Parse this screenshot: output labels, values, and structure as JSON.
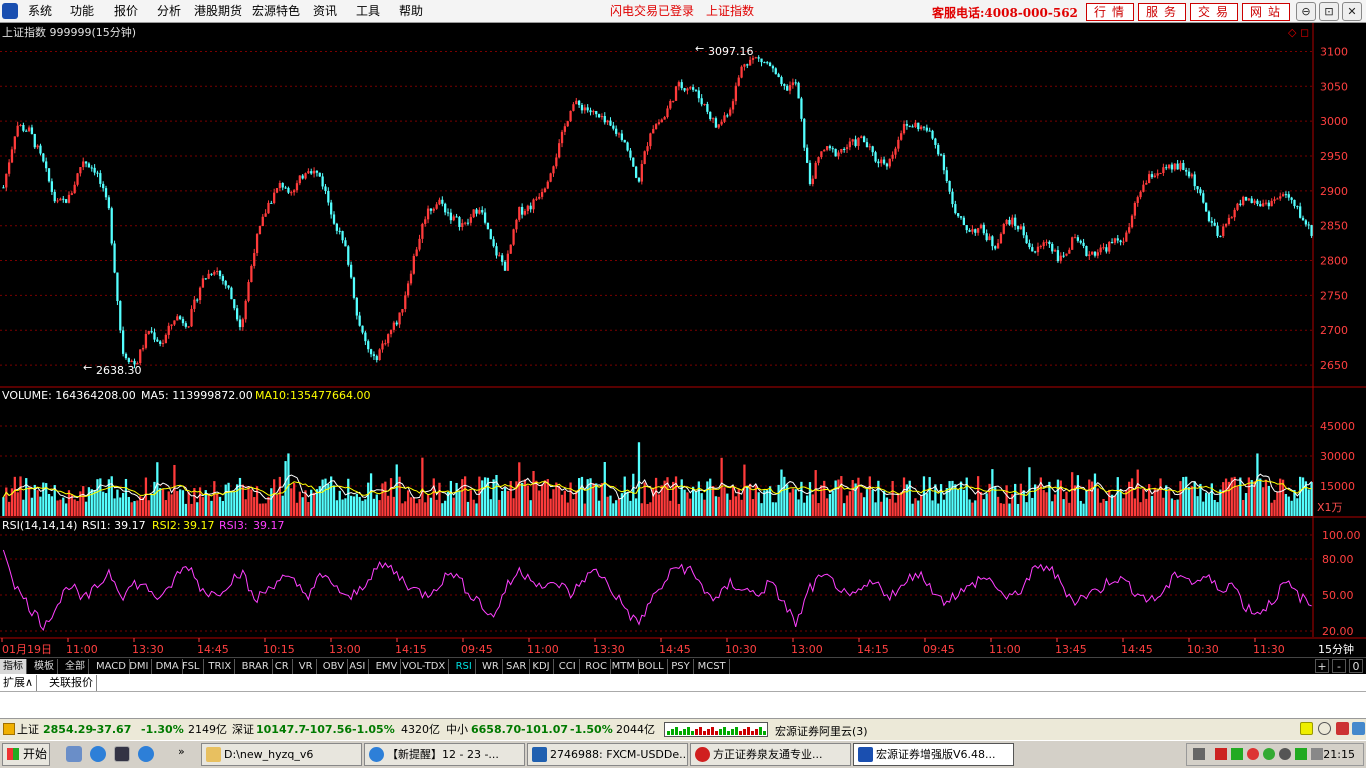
{
  "menu": {
    "items": [
      "系统",
      "功能",
      "报价",
      "分析",
      "港股期货",
      "宏源特色",
      "资讯",
      "工具",
      "帮助"
    ]
  },
  "status": {
    "login": "闪电交易已登录",
    "index": "上证指数"
  },
  "hotline": "客服电话:4008-000-562",
  "top_buttons": [
    "行情",
    "服务",
    "交易",
    "网站"
  ],
  "window_buttons": [
    "⊖",
    "⊡",
    "✕"
  ],
  "chart": {
    "title": "上证指数 999999(15分钟)",
    "price_axis": [
      "3100",
      "3050",
      "3000",
      "2950",
      "2900",
      "2850",
      "2800",
      "2750",
      "2700",
      "2650"
    ],
    "high_label": "3097.16",
    "low_label": "2638.30",
    "volume_header": {
      "label": "VOLUME: 164364208.00",
      "ma5": "MA5: 113999872.00",
      "ma10_name": "MA10:",
      "ma10_value": "135477664.00"
    },
    "volume_axis": [
      "45000",
      "30000",
      "15000"
    ],
    "volume_unit": "X1万",
    "rsi_header": {
      "label": "RSI(14,14,14)",
      "rsi1": "RSI1: 39.17",
      "rsi2_name": "RSI2:",
      "rsi2_value": "39.17",
      "rsi3_name": "RSI3:",
      "rsi3_value": "39.17"
    },
    "rsi_axis": [
      "100.00",
      "80.00",
      "50.00",
      "20.00"
    ],
    "time_labels": [
      "01月19日",
      "11:00",
      "13:30",
      "14:45",
      "10:15",
      "13:00",
      "14:15",
      "09:45",
      "11:00",
      "13:30",
      "14:45",
      "10:30",
      "13:00",
      "14:15",
      "09:45",
      "11:00",
      "13:45",
      "14:45",
      "10:30",
      "11:30"
    ],
    "period": "15分钟"
  },
  "chart_data": {
    "type": "candlestick",
    "title": "上证指数 999999(15分钟)",
    "ylim": [
      2620,
      3115
    ],
    "high": 3097.16,
    "low": 2638.3,
    "close_path": [
      2905,
      2995,
      2985,
      2940,
      2880,
      2890,
      2945,
      2930,
      2870,
      2670,
      2650,
      2700,
      2680,
      2720,
      2710,
      2770,
      2790,
      2760,
      2705,
      2820,
      2880,
      2910,
      2900,
      2935,
      2920,
      2860,
      2810,
      2700,
      2655,
      2690,
      2720,
      2800,
      2870,
      2885,
      2860,
      2850,
      2880,
      2820,
      2790,
      2870,
      2880,
      2910,
      2960,
      3025,
      3020,
      3005,
      2990,
      2975,
      2910,
      2990,
      3005,
      3050,
      3050,
      3025,
      2990,
      3020,
      3085,
      3090,
      3080,
      3045,
      3055,
      2910,
      2960,
      2955,
      2965,
      2975,
      2945,
      2940,
      2990,
      2995,
      2985,
      2950,
      2865,
      2845,
      2845,
      2820,
      2860,
      2845,
      2810,
      2830,
      2800,
      2830,
      2810,
      2815,
      2825,
      2835,
      2900,
      2925,
      2930,
      2935,
      2920,
      2870,
      2830,
      2870,
      2890,
      2880,
      2885,
      2895,
      2870,
      2840
    ],
    "volume_axis": [
      15000,
      30000,
      45000
    ],
    "volume_unit": "X1万",
    "rsi_path": [
      90,
      55,
      40,
      25,
      40,
      60,
      45,
      55,
      70,
      50,
      60,
      55,
      45,
      65,
      75,
      55,
      50,
      60,
      70,
      45,
      55,
      65,
      60,
      50,
      65,
      60,
      45,
      55,
      70,
      75,
      65,
      55,
      50,
      60,
      70,
      55,
      45,
      30,
      55,
      70,
      65,
      55,
      60,
      50,
      65,
      70,
      55,
      40,
      25,
      45,
      60,
      75,
      70,
      55,
      45,
      60,
      55,
      50,
      60,
      45,
      25,
      55,
      65,
      60,
      45,
      55,
      60,
      50,
      55,
      70,
      60,
      45,
      50,
      55,
      65,
      60,
      45,
      55,
      70,
      75,
      60,
      45,
      50,
      55,
      65,
      60,
      50,
      45,
      55,
      70,
      60,
      65,
      55,
      60,
      40,
      35,
      45,
      60,
      50,
      40
    ],
    "rsi_axis": [
      20,
      50,
      80,
      100
    ],
    "rsi1": 39.17,
    "rsi2": 39.17,
    "rsi3": 39.17,
    "colors": {
      "up": "#ff3b3b",
      "down": "#54ffff",
      "ma5": "#ffffff",
      "ma10": "#ffff00",
      "rsi": "#ff40ff"
    }
  },
  "indicator_tabs": [
    "指标",
    "模板",
    "全部",
    "MACD",
    "DMI",
    "DMA",
    "FSL",
    "TRIX",
    "BRAR",
    "CR",
    "VR",
    "OBV",
    "ASI",
    "EMV",
    "VOL-TDX",
    "RSI",
    "WR",
    "SAR",
    "KDJ",
    "CCI",
    "ROC",
    "MTM",
    "BOLL",
    "PSY",
    "MCST"
  ],
  "active_tab": "RSI",
  "zoom_buttons": [
    "+",
    "-",
    "0"
  ],
  "sub_tabs": [
    "扩展∧",
    "关联报价"
  ],
  "quotes": [
    {
      "name": "上证",
      "value": "2854.29",
      "change": "-37.67",
      "pct": "-1.30%",
      "amount": "2149亿"
    },
    {
      "name": "深证",
      "value": "10147.7",
      "change": "-107.56",
      "pct": "-1.05%",
      "amount": "4320亿"
    },
    {
      "name": "中小",
      "value": "6658.70",
      "change": "-101.07",
      "pct": "-1.50%",
      "amount": "2044亿"
    }
  ],
  "broker": "宏源证券阿里云(3)",
  "taskbar": {
    "start": "开始",
    "tasks": [
      "D:\\new_hyzq_v6",
      "【新提醒】12 - 23 -...",
      "2746988: FXCM-USDDe...",
      "方正证券泉友通专业...",
      "宏源证券增强版V6.48..."
    ],
    "clock": "21:15"
  }
}
